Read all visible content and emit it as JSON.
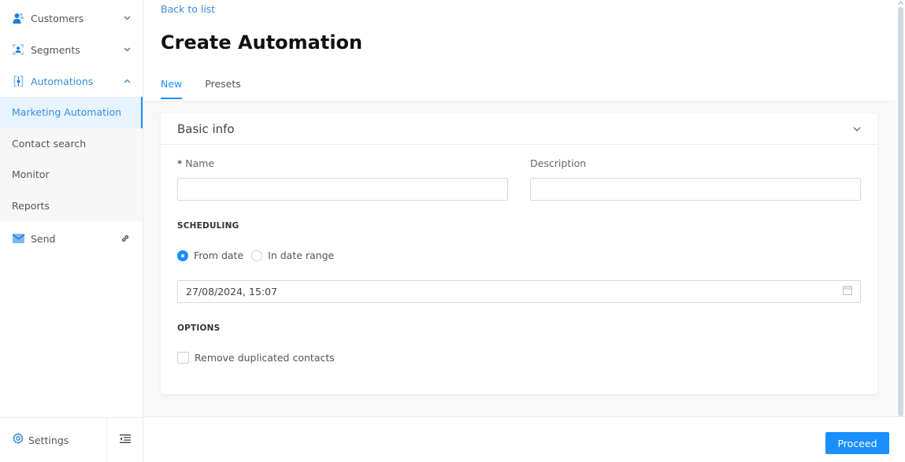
{
  "sidebar": {
    "groups": [
      {
        "label": "Customers",
        "icon": "user-icon",
        "expanded": false
      },
      {
        "label": "Segments",
        "icon": "segment-icon",
        "expanded": false
      },
      {
        "label": "Automations",
        "icon": "automation-icon",
        "expanded": true
      }
    ],
    "sub_items": [
      {
        "label": "Marketing Automation",
        "active": true
      },
      {
        "label": "Contact search",
        "active": false
      },
      {
        "label": "Monitor",
        "active": false
      },
      {
        "label": "Reports",
        "active": false
      }
    ],
    "send": {
      "label": "Send",
      "icon": "mail-icon",
      "action_icon": "link-icon"
    },
    "footer": {
      "settings_label": "Settings",
      "collapse_icon": "collapse-menu-icon"
    }
  },
  "header": {
    "back_link": "Back to list",
    "title": "Create Automation",
    "tabs": [
      {
        "label": "New",
        "active": true
      },
      {
        "label": "Presets",
        "active": false
      }
    ]
  },
  "card": {
    "title": "Basic info",
    "name_label": "Name",
    "name_required": "*",
    "name_value": "",
    "description_label": "Description",
    "description_value": "",
    "scheduling": {
      "title": "SCHEDULING",
      "options": [
        {
          "label": "From date",
          "checked": true
        },
        {
          "label": "In date range",
          "checked": false
        }
      ],
      "date_value": "27/08/2024, 15:07"
    },
    "options": {
      "title": "OPTIONS",
      "checkbox_label": "Remove duplicated contacts",
      "checked": false
    }
  },
  "footer": {
    "proceed_label": "Proceed"
  },
  "colors": {
    "accent": "#1890ff",
    "link": "#3a8de0",
    "active_bg": "#e7f3fe"
  }
}
